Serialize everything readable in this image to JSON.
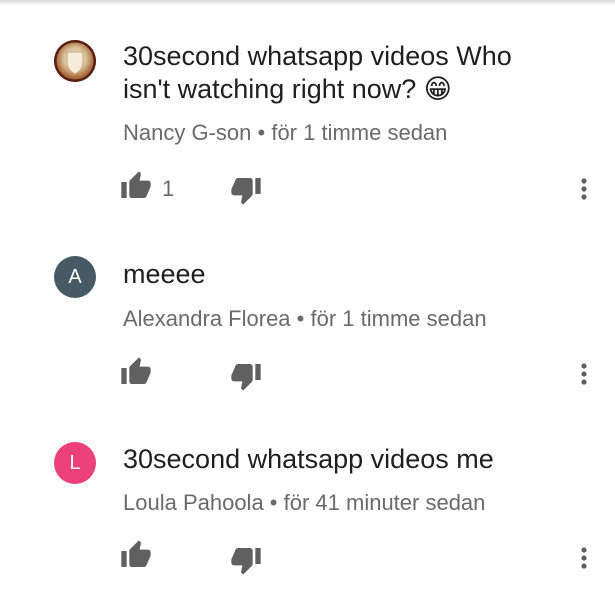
{
  "comments": [
    {
      "author": "Nancy G-son",
      "avatar_letter": "",
      "avatar_type": "photo",
      "text": "30second whatsapp videos Who isn't watching right now? 😁",
      "time": "för 1 timme sedan",
      "like_count": "1"
    },
    {
      "author": "Alexandra Florea",
      "avatar_letter": "A",
      "avatar_type": "letter",
      "avatar_color": "#455a64",
      "text": "meeee",
      "time": "för 1 timme sedan",
      "like_count": ""
    },
    {
      "author": "Loula Pahoola",
      "avatar_letter": "L",
      "avatar_type": "letter",
      "avatar_color": "#ec407a",
      "text": "30second whatsapp videos me",
      "time": "för 41 minuter sedan",
      "like_count": ""
    }
  ],
  "meta_separator": " • ",
  "icons": {
    "like": "thumb-up-icon",
    "dislike": "thumb-down-icon",
    "more": "more-vert-icon"
  },
  "colors": {
    "icon": "#606060",
    "text": "#1f1f1f",
    "meta": "#6a6a6a"
  }
}
